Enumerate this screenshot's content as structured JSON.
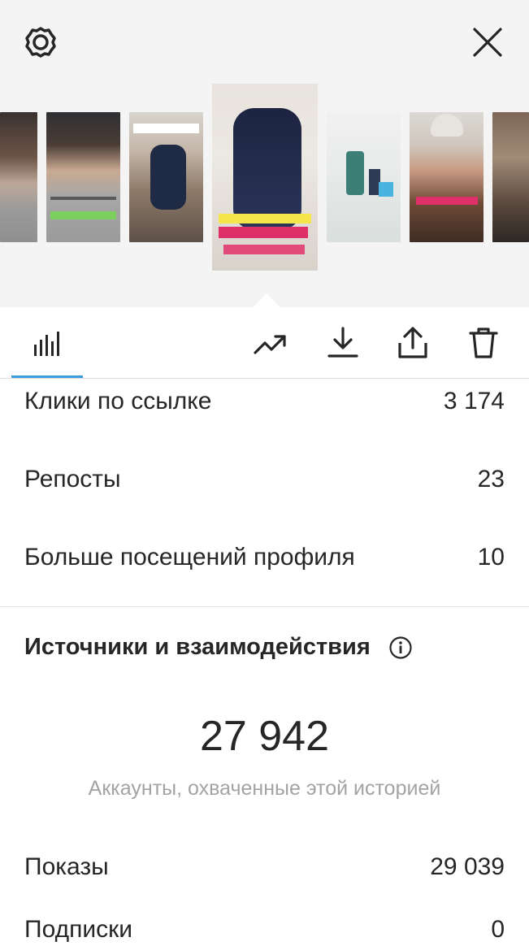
{
  "header": {
    "settings_icon": "settings-gear-icon",
    "close_icon": "close-x-icon"
  },
  "stories": [
    {
      "caption": "",
      "scene": "woman-in-grey-sweater"
    },
    {
      "caption": "",
      "scene": "woman-in-grey-sweater"
    },
    {
      "caption": "",
      "scene": "hand-holding-product"
    },
    {
      "caption": "",
      "scene": "product-bottle-selected"
    },
    {
      "caption": "",
      "scene": "product-jars-screenshot"
    },
    {
      "caption": "",
      "scene": "woman-in-hat"
    },
    {
      "caption": "",
      "scene": "street-scene"
    }
  ],
  "toolbar": {
    "tab_icon": "insights-bars-icon",
    "promote_icon": "trending-up-icon",
    "download_icon": "download-icon",
    "share_icon": "share-icon",
    "delete_icon": "trash-icon"
  },
  "stats": [
    {
      "label": "Клики по ссылке",
      "value": "3 174"
    },
    {
      "label": "Репосты",
      "value": "23"
    },
    {
      "label": "Больше посещений профиля",
      "value": "10"
    }
  ],
  "sources": {
    "title": "Источники и взаимодействия",
    "info_icon": "info-icon",
    "reach_value": "27 942",
    "reach_caption": "Аккаунты, охваченные этой историей",
    "rows": [
      {
        "label": "Показы",
        "value": "29 039"
      },
      {
        "label": "Подписки",
        "value": "0"
      }
    ]
  }
}
